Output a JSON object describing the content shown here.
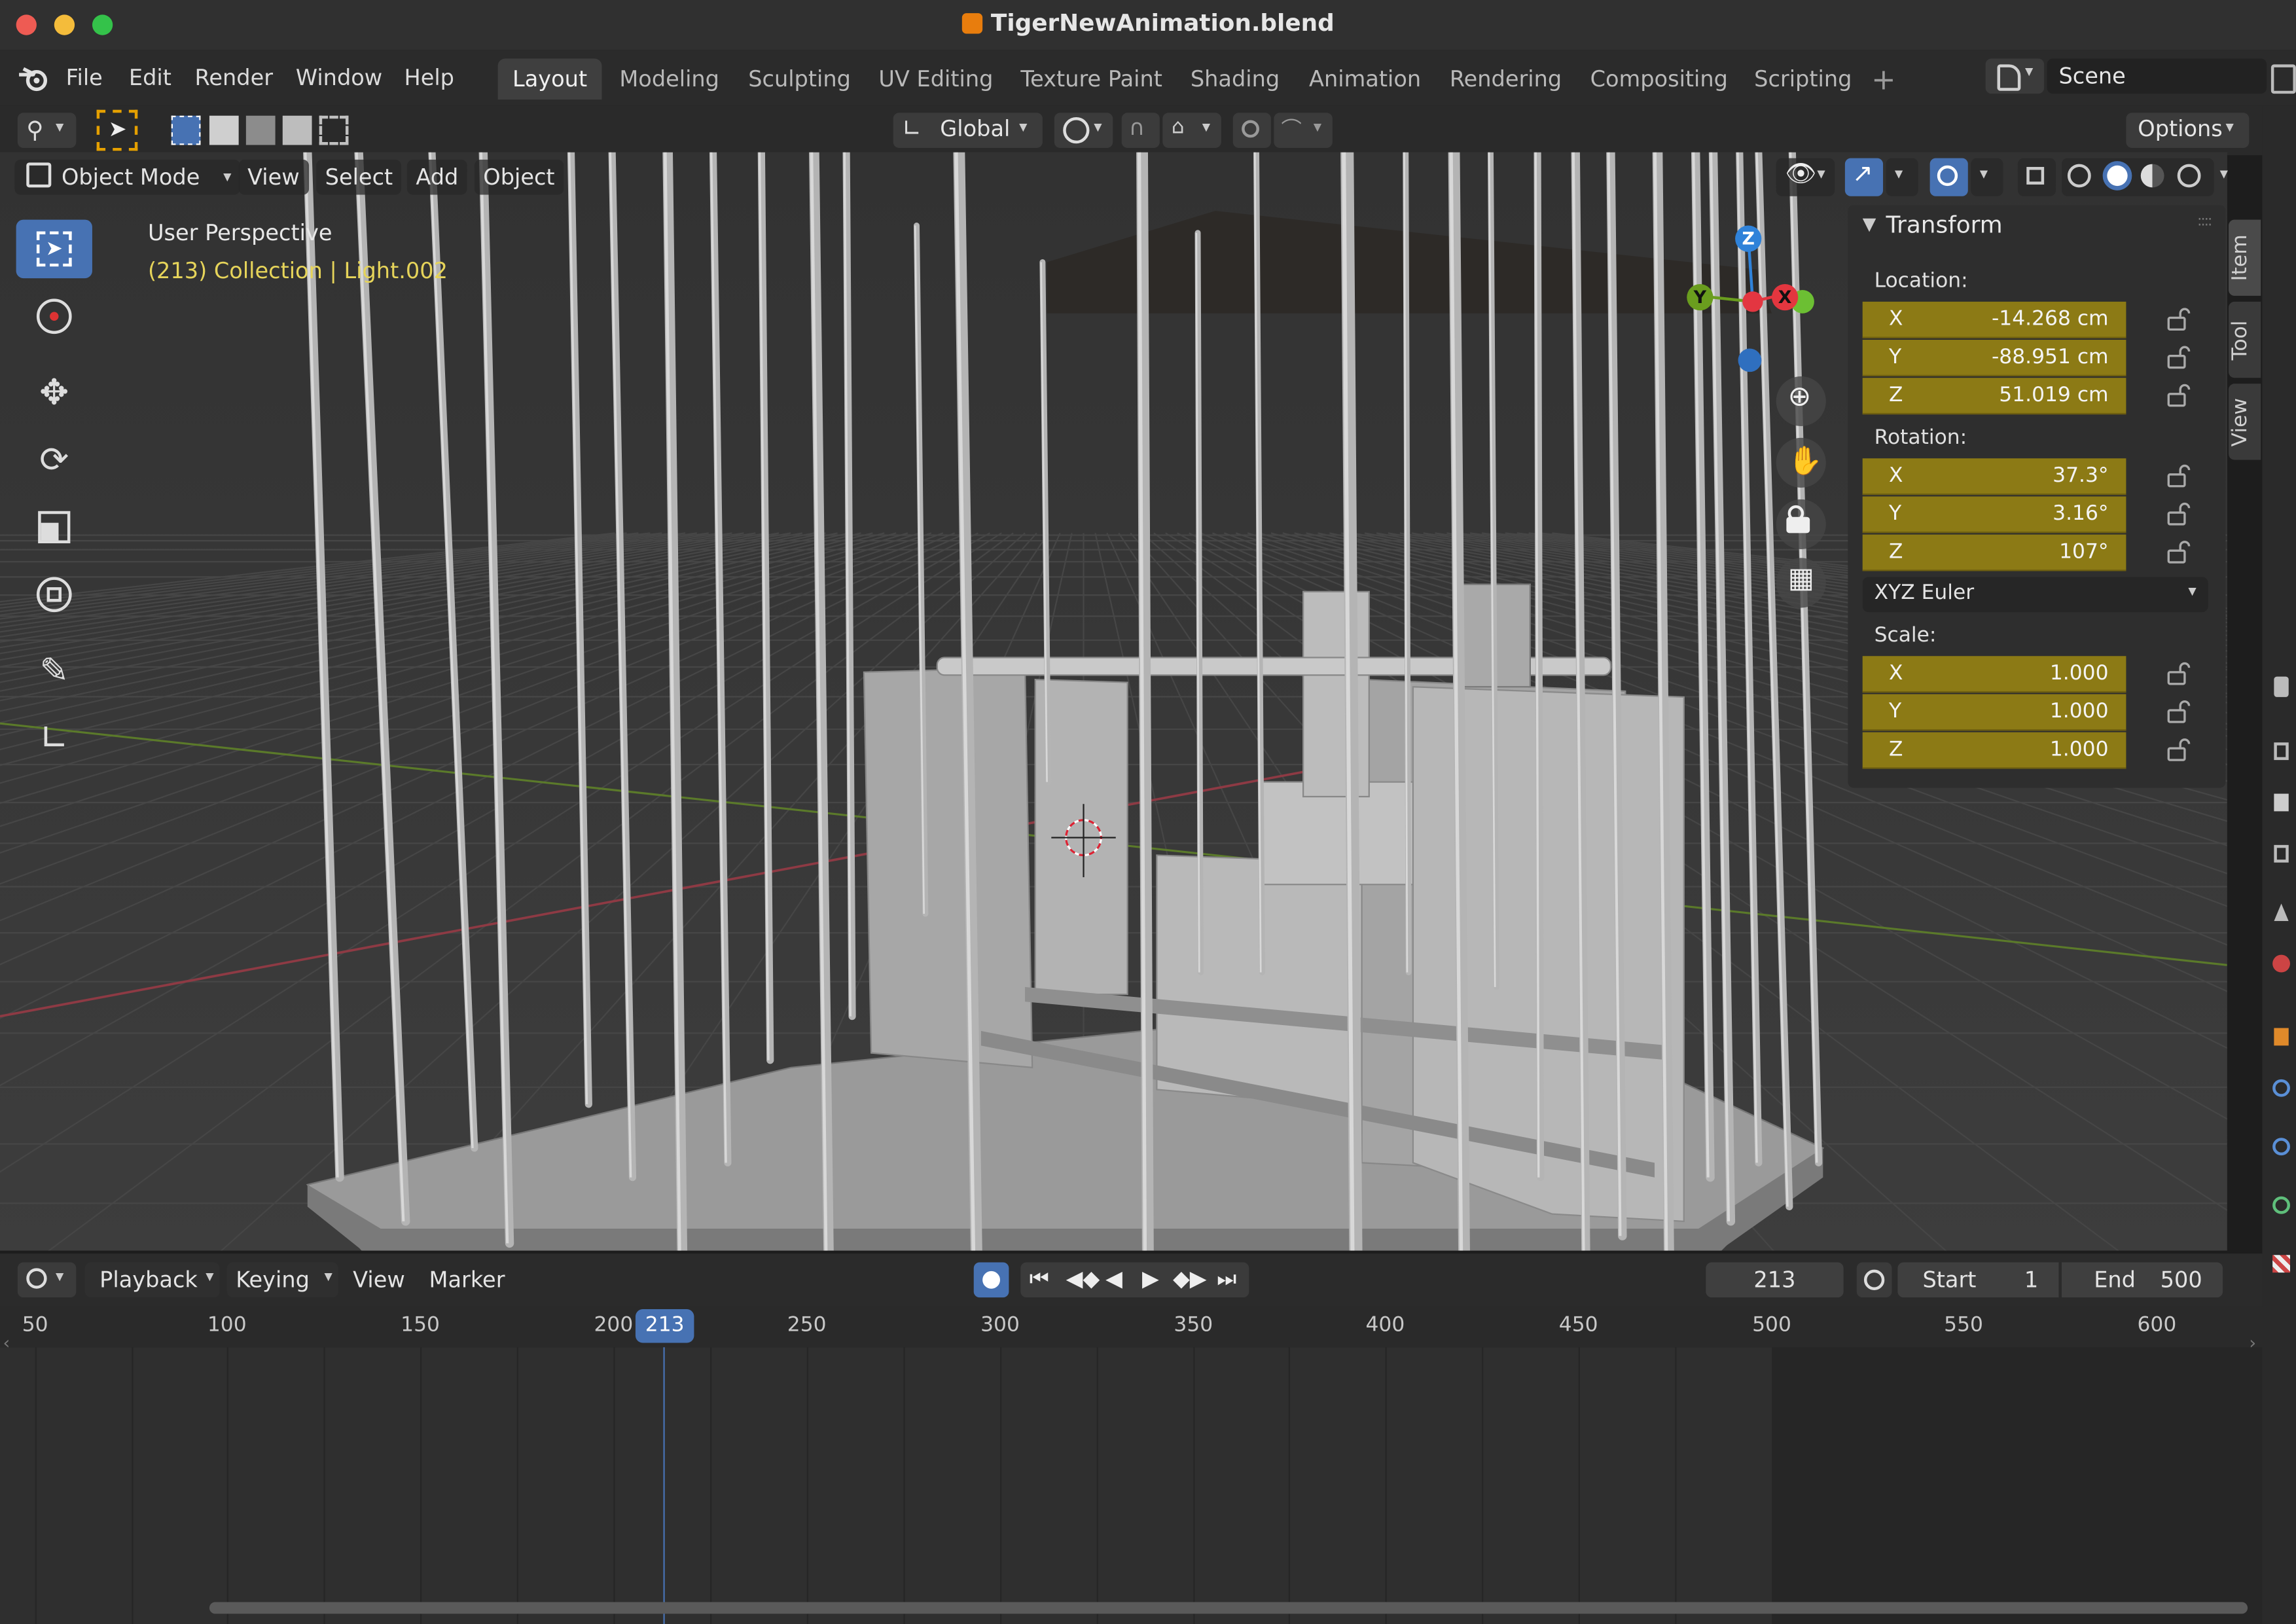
{
  "window": {
    "title": "TigerNewAnimation.blend",
    "colors": {
      "close": "#ee5b53",
      "minimize": "#f4bc3b",
      "maximize": "#34c24a"
    }
  },
  "menu": {
    "items": [
      "File",
      "Edit",
      "Render",
      "Window",
      "Help"
    ],
    "logo_icon": "blender-logo-icon"
  },
  "workspaces": {
    "tabs": [
      "Layout",
      "Modeling",
      "Sculpting",
      "UV Editing",
      "Texture Paint",
      "Shading",
      "Animation",
      "Rendering",
      "Compositing",
      "Scripting"
    ],
    "active": "Layout",
    "add_label": "+"
  },
  "scene": {
    "name": "Scene"
  },
  "toolbar": {
    "orientation": "Global",
    "options_label": "Options"
  },
  "viewport_header": {
    "mode": "Object Mode",
    "menus": [
      "View",
      "Select",
      "Add",
      "Object"
    ]
  },
  "viewport": {
    "perspective_label": "User Perspective",
    "collection_label": "(213) Collection | Light.002",
    "gizmo_axes": {
      "x": "X",
      "y": "Y",
      "z": "Z"
    },
    "axis_colors": {
      "x": "#e3363f",
      "y": "#6a9d1e",
      "z": "#2f82d9"
    }
  },
  "npanel": {
    "section": "Transform",
    "location_label": "Location:",
    "location": [
      {
        "axis": "X",
        "value": "-14.268 cm"
      },
      {
        "axis": "Y",
        "value": "-88.951 cm"
      },
      {
        "axis": "Z",
        "value": "51.019 cm"
      }
    ],
    "rotation_label": "Rotation:",
    "rotation": [
      {
        "axis": "X",
        "value": "37.3°"
      },
      {
        "axis": "Y",
        "value": "3.16°"
      },
      {
        "axis": "Z",
        "value": "107°"
      }
    ],
    "rotation_mode": "XYZ Euler",
    "scale_label": "Scale:",
    "scale": [
      {
        "axis": "X",
        "value": "1.000"
      },
      {
        "axis": "Y",
        "value": "1.000"
      },
      {
        "axis": "Z",
        "value": "1.000"
      }
    ],
    "tabs": [
      "Item",
      "Tool",
      "View"
    ],
    "field_color": "#8c7a15"
  },
  "timeline": {
    "menus": [
      "Playback",
      "Keying",
      "View",
      "Marker"
    ],
    "current_frame": "213",
    "start_label": "Start",
    "start": "1",
    "end_label": "End",
    "end": "500",
    "ruler_ticks": [
      "50",
      "100",
      "150",
      "200",
      "250",
      "300",
      "350",
      "400",
      "450",
      "500",
      "550",
      "600"
    ],
    "playhead_color": "#4772b3"
  }
}
